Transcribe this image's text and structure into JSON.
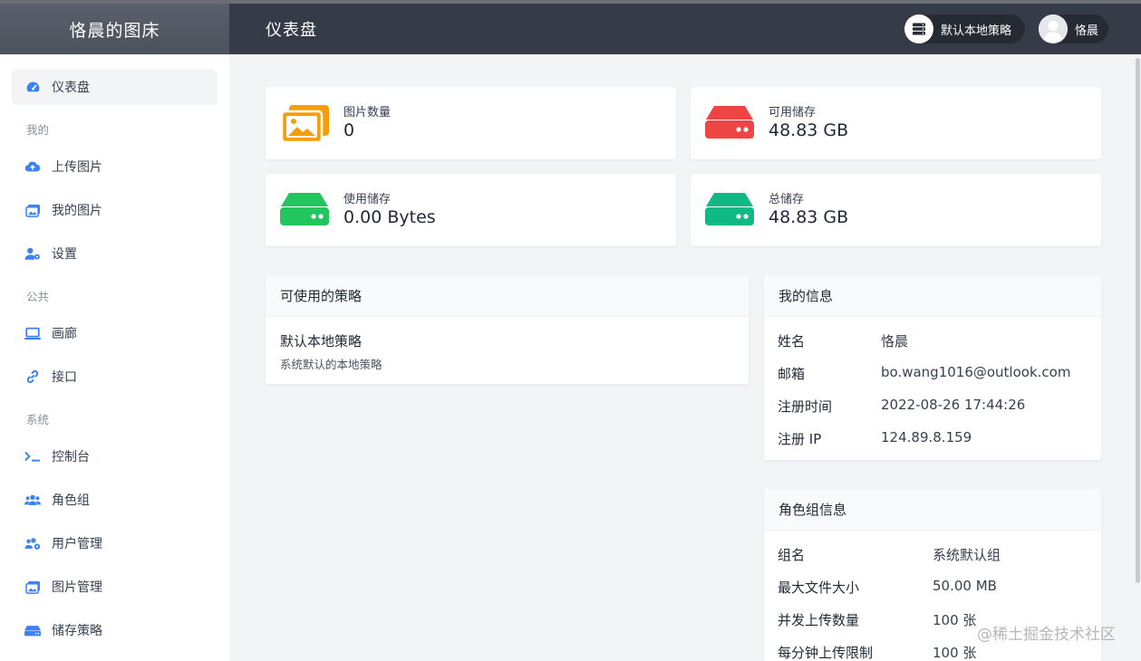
{
  "app": {
    "brand": "恪晨的图床",
    "page_title": "仪表盘"
  },
  "header": {
    "strategy_label": "默认本地策略",
    "user_name": "恪晨"
  },
  "sidebar": {
    "dashboard": "仪表盘",
    "groups": {
      "mine": "我的",
      "public": "公共",
      "system": "系统"
    },
    "items": {
      "upload": "上传图片",
      "my_images": "我的图片",
      "settings": "设置",
      "gallery": "画廊",
      "api": "接口",
      "console": "控制台",
      "roles": "角色组",
      "users": "用户管理",
      "images_manage": "图片管理",
      "storage_strategy": "储存策略"
    }
  },
  "stats": {
    "image_count": {
      "label": "图片数量",
      "value": "0"
    },
    "available_storage": {
      "label": "可用储存",
      "value": "48.83 GB"
    },
    "used_storage": {
      "label": "使用储存",
      "value": "0.00 Bytes"
    },
    "total_storage": {
      "label": "总储存",
      "value": "48.83 GB"
    }
  },
  "policies": {
    "title": "可使用的策略",
    "name": "默认本地策略",
    "description": "系统默认的本地策略"
  },
  "my_info": {
    "title": "我的信息",
    "name_label": "姓名",
    "name_value": "恪晨",
    "email_label": "邮箱",
    "email_value": "bo.wang1016@outlook.com",
    "reg_time_label": "注册时间",
    "reg_time_value": "2022-08-26 17:44:26",
    "reg_ip_label": "注册 IP",
    "reg_ip_value": "124.89.8.159"
  },
  "role_info": {
    "title": "角色组信息",
    "group_label": "组名",
    "group_value": "系统默认组",
    "max_size_label": "最大文件大小",
    "max_size_value": "50.00 MB",
    "concurrent_label": "并发上传数量",
    "concurrent_value": "100 张",
    "per_minute_label": "每分钟上传限制",
    "per_minute_value": "100 张"
  },
  "watermark": "@稀土掘金技术社区",
  "colors": {
    "accent_blue": "#3b82f6",
    "image_icon": "#f59e0b",
    "available_icon": "#ef4444",
    "used_icon": "#22c55e",
    "total_icon": "#10b981",
    "header_bg": "#353c48"
  }
}
